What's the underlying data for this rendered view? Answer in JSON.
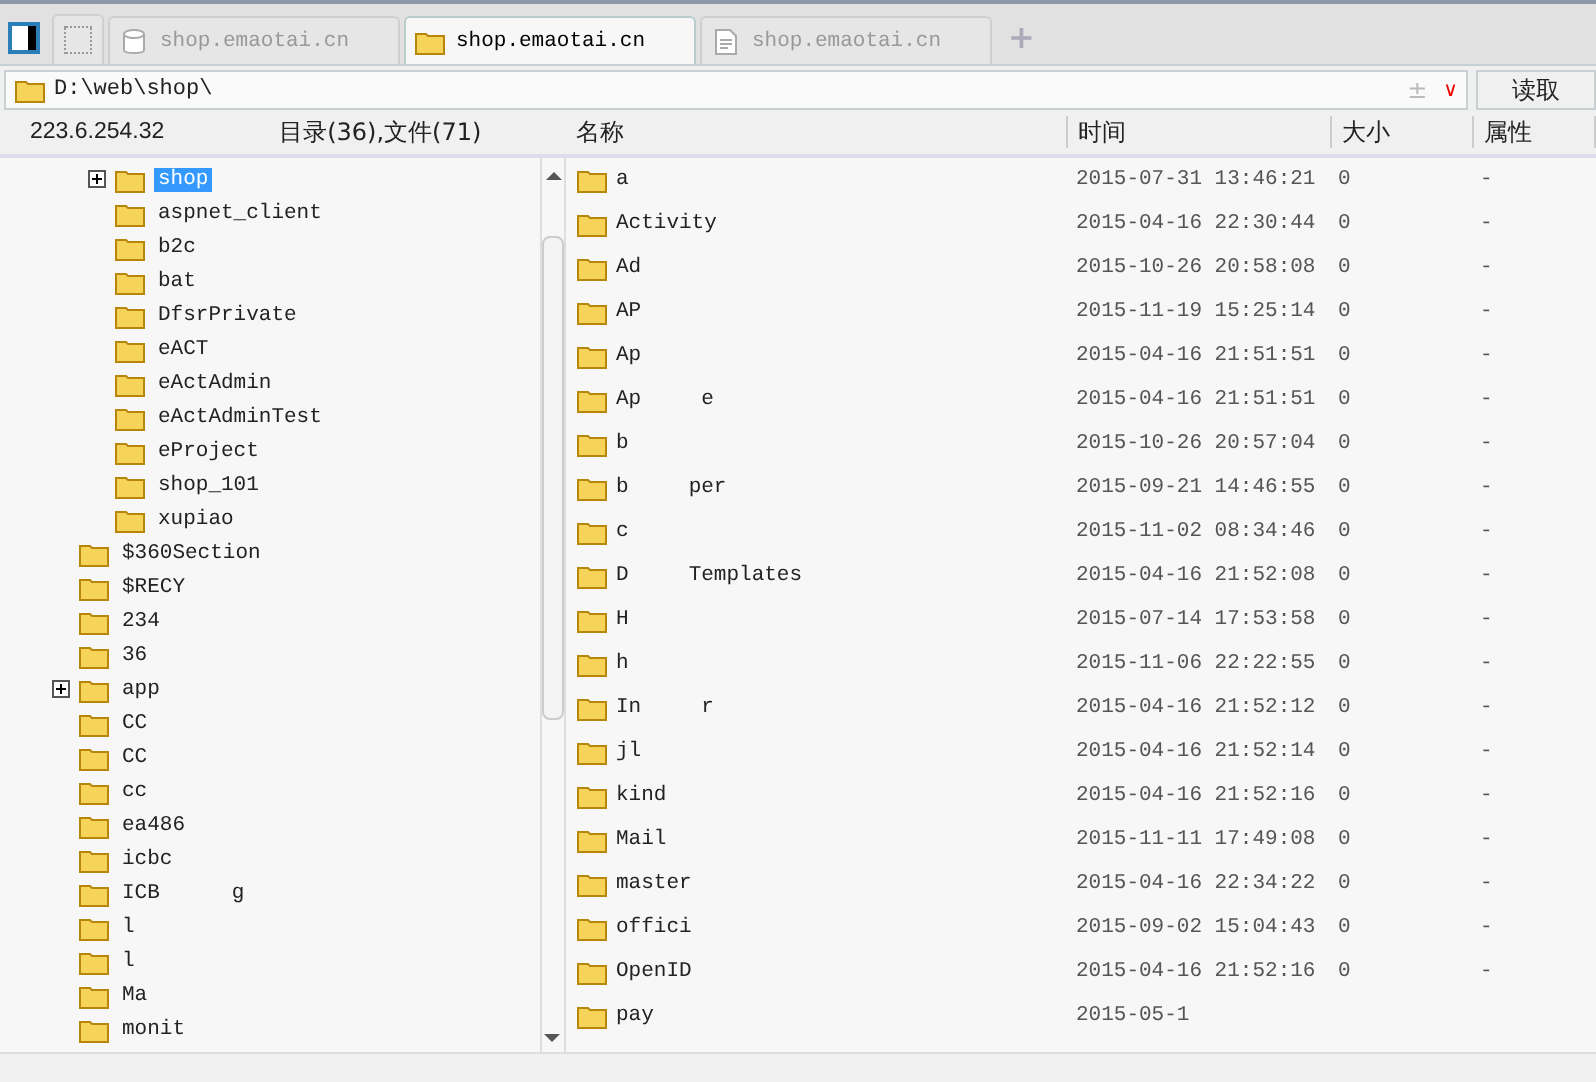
{
  "tabs": [
    {
      "label": "shop.emaotai.cn",
      "kind": "database",
      "selected": false
    },
    {
      "label": "shop.emaotai.cn",
      "kind": "folder",
      "selected": true
    },
    {
      "label": "shop.emaotai.cn",
      "kind": "document",
      "selected": false
    }
  ],
  "new_tab": "+",
  "address": {
    "value": "D:\\web\\shop\\",
    "toggle": "±",
    "dropdown": "∨",
    "button": "读取"
  },
  "header": {
    "host": "223.6.254.32",
    "counts": "目录(36),文件(71)",
    "columns": [
      "名称",
      "时间",
      "大小",
      "属性"
    ]
  },
  "tree": {
    "nested_items": [
      {
        "name": "shop",
        "expandable": true,
        "selected": true
      },
      {
        "name": "aspnet_client",
        "expandable": false,
        "selected": false
      },
      {
        "name": "b2c",
        "expandable": false,
        "selected": false
      },
      {
        "name": "bat",
        "expandable": false,
        "selected": false
      },
      {
        "name": "DfsrPrivate",
        "expandable": false,
        "selected": false
      },
      {
        "name": "eACT",
        "expandable": false,
        "selected": false
      },
      {
        "name": "eActAdmin",
        "expandable": false,
        "selected": false
      },
      {
        "name": "eActAdminTest",
        "expandable": false,
        "selected": false
      },
      {
        "name": "eProject",
        "expandable": false,
        "selected": false
      },
      {
        "name": "shop_101",
        "expandable": false,
        "selected": false
      },
      {
        "name": "xupiao",
        "expandable": false,
        "selected": false
      }
    ],
    "items": [
      {
        "name": "$360Section",
        "expandable": false,
        "selected": false
      },
      {
        "name": "$RECY",
        "expandable": false,
        "selected": false
      },
      {
        "name": "234",
        "expandable": false,
        "selected": false
      },
      {
        "name": "36",
        "expandable": false,
        "selected": false
      },
      {
        "name": "app",
        "expandable": true,
        "selected": false
      },
      {
        "name": "CC",
        "expandable": false,
        "selected": false
      },
      {
        "name": "CC",
        "expandable": false,
        "selected": false
      },
      {
        "name": "cc",
        "expandable": false,
        "selected": false
      },
      {
        "name": "ea486",
        "expandable": false,
        "selected": false
      },
      {
        "name": "icbc",
        "expandable": false,
        "selected": false
      },
      {
        "name": "ICB",
        "tail": "g",
        "expandable": false,
        "selected": false
      },
      {
        "name": "l",
        "expandable": false,
        "selected": false
      },
      {
        "name": "l",
        "expandable": false,
        "selected": false
      },
      {
        "name": "Ma",
        "expandable": false,
        "selected": false
      },
      {
        "name": "monit",
        "expandable": false,
        "selected": false
      }
    ]
  },
  "files": [
    {
      "name": "a",
      "time": "2015-07-31 13:46:21",
      "size": "0",
      "attr": "-"
    },
    {
      "name": "Activity",
      "time": "2015-04-16 22:30:44",
      "size": "0",
      "attr": "-"
    },
    {
      "name": "Ad",
      "time": "2015-10-26 20:58:08",
      "size": "0",
      "attr": "-"
    },
    {
      "name": "AP",
      "time": "2015-11-19 15:25:14",
      "size": "0",
      "attr": "-"
    },
    {
      "name": "Ap",
      "time": "2015-04-16 21:51:51",
      "size": "0",
      "attr": "-"
    },
    {
      "name": "Ap",
      "tail": "e",
      "time": "2015-04-16 21:51:51",
      "size": "0",
      "attr": "-"
    },
    {
      "name": "b",
      "time": "2015-10-26 20:57:04",
      "size": "0",
      "attr": "-"
    },
    {
      "name": "b",
      "tail": "per",
      "time": "2015-09-21 14:46:55",
      "size": "0",
      "attr": "-"
    },
    {
      "name": "c",
      "time": "2015-11-02 08:34:46",
      "size": "0",
      "attr": "-"
    },
    {
      "name": "D",
      "tail": "Templates",
      "time": "2015-04-16 21:52:08",
      "size": "0",
      "attr": "-"
    },
    {
      "name": "H",
      "time": "2015-07-14 17:53:58",
      "size": "0",
      "attr": "-"
    },
    {
      "name": "h",
      "time": "2015-11-06 22:22:55",
      "size": "0",
      "attr": "-"
    },
    {
      "name": "In",
      "tail": "r",
      "time": "2015-04-16 21:52:12",
      "size": "0",
      "attr": "-"
    },
    {
      "name": "jl",
      "time": "2015-04-16 21:52:14",
      "size": "0",
      "attr": "-"
    },
    {
      "name": "kind",
      "time": "2015-04-16 21:52:16",
      "size": "0",
      "attr": "-"
    },
    {
      "name": "Mail",
      "time": "2015-11-11 17:49:08",
      "size": "0",
      "attr": "-"
    },
    {
      "name": "master",
      "time": "2015-04-16 22:34:22",
      "size": "0",
      "attr": "-"
    },
    {
      "name": "offici",
      "time": "2015-09-02 15:04:43",
      "size": "0",
      "attr": "-"
    },
    {
      "name": "OpenID",
      "time": "2015-04-16 21:52:16",
      "size": "0",
      "attr": "-"
    },
    {
      "name": "pay",
      "time": "2015-05-1"
    }
  ]
}
